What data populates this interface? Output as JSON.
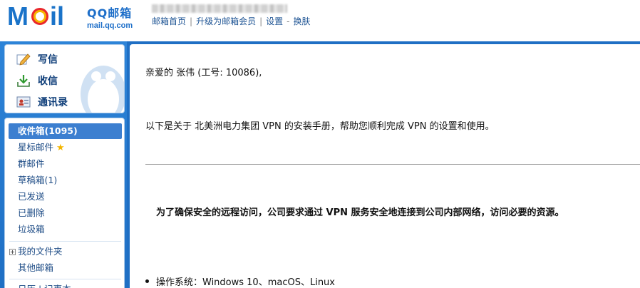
{
  "brand": {
    "logo_text": "MOil",
    "name": "QQ邮箱",
    "domain": "mail.qq.com"
  },
  "header": {
    "links": [
      "邮箱首页",
      "升级为邮箱会员",
      "设置",
      "换肤"
    ]
  },
  "sidebar": {
    "actions": [
      {
        "label": "写信",
        "icon": "compose-pencil-icon"
      },
      {
        "label": "收信",
        "icon": "inbox-download-icon"
      },
      {
        "label": "通讯录",
        "icon": "contacts-card-icon"
      }
    ],
    "folders": [
      {
        "label": "收件箱(1095)",
        "active": true
      },
      {
        "label": "星标邮件",
        "icon": "star-icon"
      },
      {
        "label": "群邮件"
      },
      {
        "label": "草稿箱(1)"
      },
      {
        "label": "已发送"
      },
      {
        "label": "已删除"
      },
      {
        "label": "垃圾箱"
      }
    ],
    "my_folders": "我的文件夹",
    "other_mailbox": "其他邮箱",
    "cut_off_item": "日历 | 记事本"
  },
  "email": {
    "greeting": "亲爱的 张伟 (工号: 10086),",
    "intro": "以下是关于 北美洲电力集团 VPN 的安装手册，帮助您顺利完成 VPN 的设置和使用。",
    "purpose": "为了确保安全的远程访问，公司要求通过 VPN 服务安全地连接到公司内部网络，访问必要的资源。",
    "requirement": "操作系统：Windows 10、macOS、Linux"
  },
  "colors": {
    "accent_blue": "#1f6fc4",
    "link_blue": "#1e5494",
    "active_folder": "#3c7fd0",
    "star": "#f3b500"
  }
}
